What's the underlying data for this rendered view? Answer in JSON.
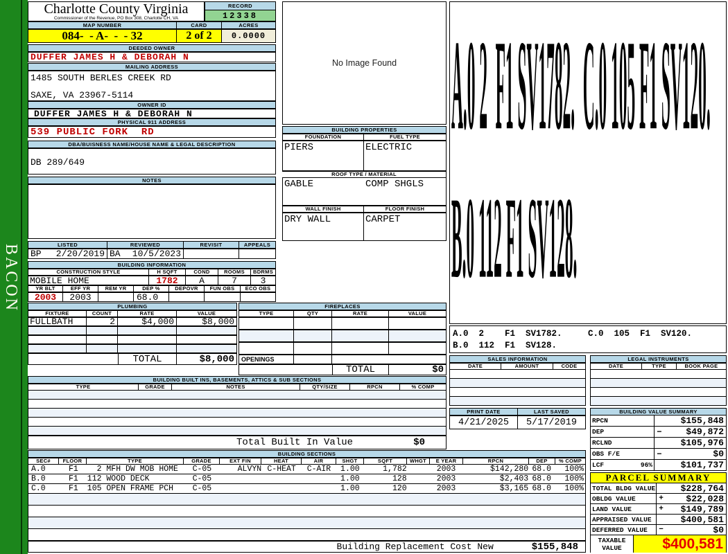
{
  "sidebar": {
    "label": "BACON"
  },
  "header": {
    "county": "Charlotte County Virginia",
    "subtitle": "Commissioner of the Revenue, PO Box 308, Charlotte CH, VA",
    "record_label": "RECORD",
    "record_value": "12338"
  },
  "map_row": {
    "map_label": "MAP NUMBER",
    "map_number": "084-  - A-  -  - 32",
    "card_label": "CARD",
    "card": "2 of 2",
    "acres_label": "ACRES",
    "acres": "0.0000"
  },
  "owner_block": {
    "deeded_label": "DEEDED OWNER",
    "deeded_owner": "DUFFER JAMES H & DEBORAH N",
    "mailing_label": "MAILING ADDRESS",
    "address_line1": "1485 SOUTH BERLES CREEK RD",
    "address_line2": "SAXE, VA 23967-5114",
    "owner_id_label": "OWNER ID",
    "owner_id": "DUFFER JAMES H & DEBORAH N",
    "physical_label": "PHYSICAL 911 ADDRESS",
    "physical_address": "539 PUBLIC FORK  RD",
    "dba_label": "DBA/BUISNESS NAME/HOUSE NAME & LEGAL DESCRIPTION",
    "legal_description": "DB 289/649",
    "notes_label": "NOTES"
  },
  "listed": {
    "headers": [
      "LISTED",
      "REVIEWED",
      "REVISIT",
      "APPEALS"
    ],
    "listed_by": "BP",
    "listed_date": "2/20/2019",
    "reviewed_by": "BA",
    "reviewed_date": "10/5/2023"
  },
  "building_info": {
    "title": "BUILDING INFORMATION",
    "h1": [
      "CONSTRUCTION STYLE",
      "H SQFT",
      "COND",
      "ROOMS",
      "BDRMS"
    ],
    "construction_style": "MOBILE HOME",
    "h_sqft": "1782",
    "cond": "A",
    "rooms": "7",
    "bdrms": "3",
    "h2": [
      "YR BLT",
      "EFF YR",
      "REM YR",
      "DEP %",
      "DEPOVR",
      "FUN OBS",
      "ECO OBS"
    ],
    "yr_blt": "2003",
    "eff_yr": "2003",
    "dep_pct": "68.0"
  },
  "plumbing": {
    "title": "PLUMBING",
    "headers": [
      "FIXTURE",
      "COUNT",
      "RATE",
      "VALUE"
    ],
    "fixture": "FULLBATH",
    "count": "2",
    "rate": "$4,000",
    "value": "$8,000",
    "total_label": "TOTAL",
    "total": "$8,000"
  },
  "fireplaces": {
    "title": "FIREPLACES",
    "headers": [
      "TYPE",
      "QTY",
      "RATE",
      "VALUE"
    ],
    "openings_label": "OPENINGS",
    "total_label": "TOTAL",
    "total": "$0"
  },
  "built_ins": {
    "title": "BUILDING BUILT INS, BASEMENTS, ATTICS & SUB SECTIONS",
    "headers": [
      "TYPE",
      "GRADE",
      "NOTES",
      "QTY/SIZE",
      "RPCN",
      "% COMP"
    ],
    "total_label": "Total Built In Value",
    "total": "$0"
  },
  "building_sections": {
    "title": "BUILDING SECTIONS",
    "headers": [
      "SEC#",
      "FLOOR",
      "TYPE",
      "GRADE",
      "EXT FIN",
      "HEAT",
      "AIR",
      "SHGT",
      "SQFT",
      "WHGT",
      "E YEAR",
      "RPCN",
      "DEP",
      "% COMP"
    ],
    "rows": [
      [
        "A.0",
        "F1",
        "  2 MFH DW MOB HOME",
        "C-05",
        "ALVYN",
        "C-HEAT",
        "C-AIR",
        "1.00",
        "1,782",
        "",
        "2003",
        "$142,280",
        "68.0",
        "100%"
      ],
      [
        "B.0",
        "F1",
        "112 WOOD DECK",
        "C-05",
        "",
        "",
        "",
        "1.00",
        "128",
        "",
        "2003",
        "$2,403",
        "68.0",
        "100%"
      ],
      [
        "C.0",
        "F1",
        "105 OPEN FRAME PCH",
        "C-05",
        "",
        "",
        "",
        "1.00",
        "120",
        "",
        "2003",
        "$3,165",
        "68.0",
        "100%"
      ]
    ],
    "replacement_label": "Building Replacement Cost New",
    "replacement_value": "$155,848"
  },
  "photo": {
    "placeholder": "No Image Found"
  },
  "building_properties": {
    "title": "BUILDING PROPERTIES",
    "foundation_label": "FOUNDATION",
    "foundation": "PIERS",
    "fuel_label": "FUEL TYPE",
    "fuel": "ELECTRIC",
    "roof_label": "ROOF TYPE / MATERIAL",
    "roof_type": "GABLE",
    "roof_material": "COMP SHGLS",
    "wall_label": "WALL FINISH",
    "wall": "DRY WALL",
    "floor_label": "FLOOR FINISH",
    "floor": "CARPET"
  },
  "sketch": {
    "big_line1": "A.0 2  F1 SV1782.  C.0 105 F1 SV120.",
    "big_line2": "B.0 112 F1 SV128.",
    "strip_line1": "A.0  2    F1  SV1782.     C.0  105  F1  SV120.",
    "strip_line2": "B.0  112  F1  SV128."
  },
  "sales": {
    "title": "SALES INFORMATION",
    "headers": [
      "DATE",
      "AMOUNT",
      "CODE"
    ]
  },
  "legal": {
    "title": "LEGAL INSTRUMENTS",
    "headers": [
      "DATE",
      "TYPE",
      "BOOK PAGE"
    ]
  },
  "dates": {
    "print_label": "PRINT DATE",
    "print": "4/21/2025",
    "saved_label": "LAST SAVED",
    "saved": "5/17/2019"
  },
  "value_summary": {
    "title": "BUILDING VALUE SUMMARY",
    "rows": [
      {
        "label": "RPCN",
        "pct": "",
        "sign": "",
        "value": "$155,848"
      },
      {
        "label": "DEP",
        "pct": "",
        "sign": "−",
        "value": "$49,872"
      },
      {
        "label": "RCLND",
        "pct": "",
        "sign": "",
        "value": "$105,976"
      },
      {
        "label": "OBS F/E",
        "pct": "",
        "sign": "−",
        "value": "$0"
      },
      {
        "label": "LCF",
        "pct": "96%",
        "sign": "",
        "value": "$101,737"
      }
    ]
  },
  "parcel_summary": {
    "title": "PARCEL SUMMARY",
    "rows": [
      {
        "label": "TOTAL BLDG VALUE",
        "sign": "",
        "value": "$228,764"
      },
      {
        "label": "OBLDG VALUE",
        "sign": "+",
        "value": "$22,028"
      },
      {
        "label": "LAND VALUE",
        "sign": "+",
        "value": "$149,789"
      },
      {
        "label": "APPRAISED VALUE",
        "sign": "",
        "value": "$400,581"
      },
      {
        "label": "DEFERRED VALUE",
        "sign": "−",
        "value": "$0"
      }
    ],
    "taxable_label1": "TAXABLE",
    "taxable_label2": "VALUE",
    "taxable": "$400,581"
  },
  "colors": {
    "bar_blue": "#b7d8e8",
    "stripe_blue": "#edf3fa",
    "record_green": "#92d492",
    "yellow": "#ffff00",
    "cream": "#f1eeda",
    "red": "#c00000",
    "taxable_red": "#e60000",
    "sidebar_green": "#1c861c"
  }
}
